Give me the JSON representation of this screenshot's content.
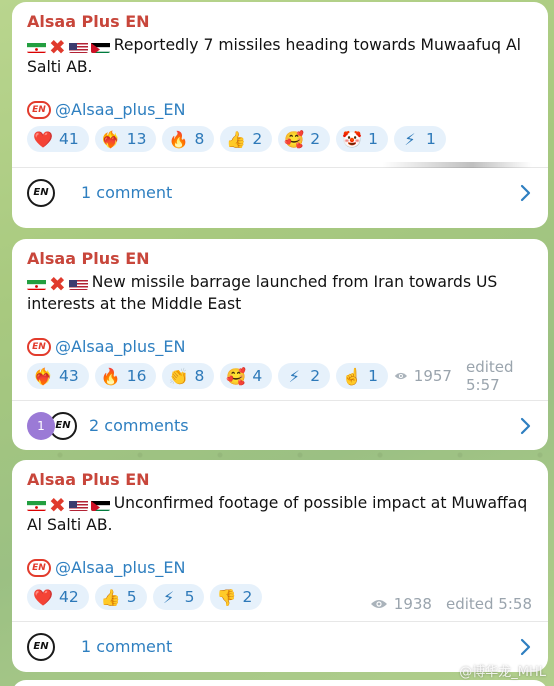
{
  "posts": [
    {
      "author": "Alsaa Plus EN",
      "flags": [
        "iran-flag",
        "cross-mark",
        "usa-flag",
        "jordan-flag"
      ],
      "text": "Reportedly 7 missiles heading towards Muwaafuq Al Salti AB.",
      "handle": "@Alsaa_plus_EN",
      "reactions": [
        {
          "icon": "red-heart-emoji",
          "glyph": "❤️",
          "count": "41"
        },
        {
          "icon": "burning-heart-emoji",
          "glyph": "❤️‍🔥",
          "count": "13"
        },
        {
          "icon": "fire-emoji",
          "glyph": "🔥",
          "count": "8"
        },
        {
          "icon": "thumbs-up-emoji",
          "glyph": "👍",
          "count": "2"
        },
        {
          "icon": "smiling-hearts-emoji",
          "glyph": "🥰",
          "count": "2"
        },
        {
          "icon": "clown-emoji",
          "glyph": "🤡",
          "count": "1"
        },
        {
          "icon": "lightning-emoji",
          "glyph": "⚡",
          "count": "1"
        }
      ],
      "views": "",
      "edited": "",
      "comments": "1 comment",
      "comment_badge": ""
    },
    {
      "author": "Alsaa Plus EN",
      "flags": [
        "iran-flag",
        "cross-mark",
        "usa-flag"
      ],
      "text": "New missile barrage launched from Iran towards US interests at the Middle East",
      "handle": "@Alsaa_plus_EN",
      "reactions": [
        {
          "icon": "burning-heart-emoji",
          "glyph": "❤️‍🔥",
          "count": "43"
        },
        {
          "icon": "fire-emoji",
          "glyph": "🔥",
          "count": "16"
        },
        {
          "icon": "clapping-emoji",
          "glyph": "👏",
          "count": "8"
        },
        {
          "icon": "smiling-hearts-emoji",
          "glyph": "🥰",
          "count": "4"
        },
        {
          "icon": "lightning-emoji",
          "glyph": "⚡",
          "count": "2"
        },
        {
          "icon": "pointing-up-emoji",
          "glyph": "☝️",
          "count": "1"
        }
      ],
      "views": "1957",
      "edited": "edited 5:57",
      "comments": "2 comments",
      "comment_badge": "1"
    },
    {
      "author": "Alsaa Plus EN",
      "flags": [
        "iran-flag",
        "cross-mark",
        "usa-flag",
        "jordan-flag"
      ],
      "text": "Unconfirmed footage of possible impact at Muwaffaq Al Salti AB.",
      "handle": "@Alsaa_plus_EN",
      "reactions": [
        {
          "icon": "red-heart-emoji",
          "glyph": "❤️",
          "count": "42"
        },
        {
          "icon": "thumbs-up-emoji",
          "glyph": "👍",
          "count": "5"
        },
        {
          "icon": "lightning-emoji",
          "glyph": "⚡",
          "count": "5"
        },
        {
          "icon": "thumbs-down-emoji",
          "glyph": "👎",
          "count": "2"
        }
      ],
      "views": "1938",
      "edited": "edited 5:58",
      "comments": "1 comment",
      "comment_badge": ""
    }
  ],
  "logo_text": "EN",
  "watermark": "@博华龙_MHL",
  "colors": {
    "author": "#c8463b",
    "link": "#2e7fc0",
    "reaction_bg": "#e6f1fb",
    "meta": "#9aa4ad",
    "background": "#a8c97f"
  }
}
